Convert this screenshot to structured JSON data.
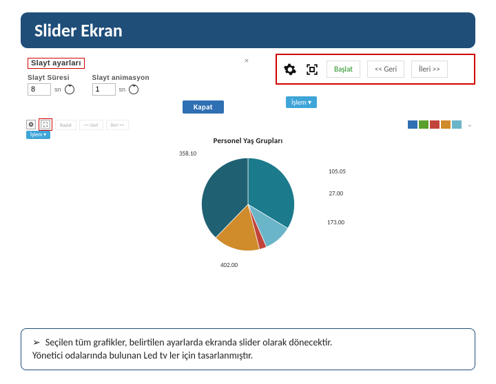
{
  "title": "Slider Ekran",
  "settings_panel": {
    "header": "Slayt ayarları",
    "duration_label": "Slayt Süresi",
    "duration_value": "8",
    "anim_label": "Slayt animasyon",
    "anim_value": "1",
    "unit": "sn",
    "close_x": "×"
  },
  "kapat_label": "Kapat",
  "toolbar": {
    "baslat": "Başlat",
    "geri": "<< Geri",
    "ileri": "İleri >>",
    "islem": "İşlem ▾"
  },
  "chart_title": "Personel Yaş Grupları",
  "legend_colors": [
    "#2f6fb3",
    "#5aa02c",
    "#c1443b",
    "#d08b2b",
    "#6bb5c9"
  ],
  "note": {
    "bullet": "➢",
    "line1": "Seçilen tüm grafikler, belirtilen ayarlarda ekranda slider olarak dönecektir.",
    "line2": "Yönetici odalarında bulunan Led tv ler için tasarlanmıştır."
  },
  "chart_data": {
    "type": "pie",
    "title": "Personel Yaş Grupları",
    "series": [
      {
        "name": "slice_a",
        "value": 358.1,
        "color": "#1b7a8c"
      },
      {
        "name": "slice_b",
        "value": 105.05,
        "color": "#6bb5c9"
      },
      {
        "name": "slice_c",
        "value": 27.0,
        "color": "#c1443b"
      },
      {
        "name": "slice_d",
        "value": 173.0,
        "color": "#d08b2b"
      },
      {
        "name": "slice_e",
        "value": 402.0,
        "color": "#1f6173"
      }
    ],
    "labels_shown": [
      "358.10",
      "105.05",
      "27.00",
      "173.00",
      "402.00"
    ]
  }
}
